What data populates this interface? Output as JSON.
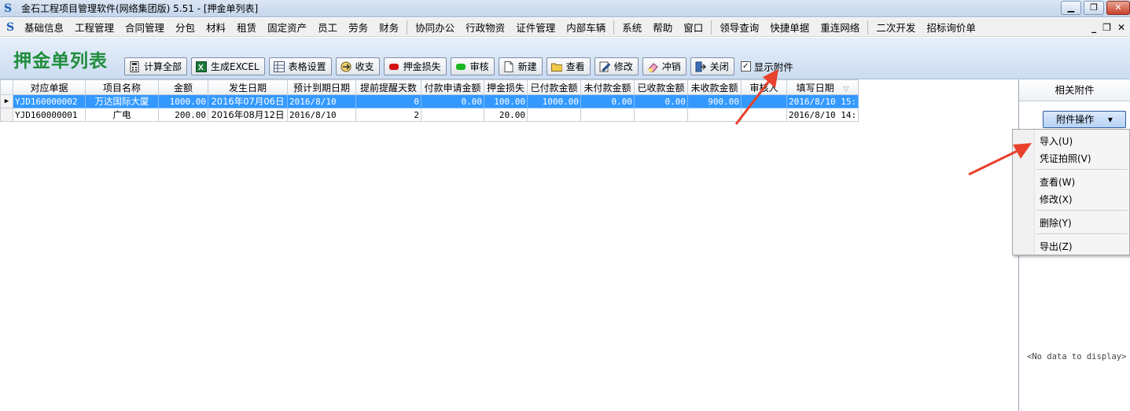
{
  "window": {
    "title": "金石工程项目管理软件(网络集团版) 5.51 - [押金单列表]",
    "minimize": "▁",
    "restore": "❐",
    "close": "✕"
  },
  "menubar": {
    "groups": [
      [
        "基础信息",
        "工程管理",
        "合同管理",
        "分包",
        "材料",
        "租赁",
        "固定资产",
        "员工",
        "劳务",
        "财务"
      ],
      [
        "协同办公",
        "行政物资",
        "证件管理",
        "内部车辆"
      ],
      [
        "系统",
        "帮助",
        "窗口"
      ],
      [
        "领导查询",
        "快捷单据",
        "重连网络"
      ],
      [
        "二次开发",
        "招标询价单"
      ]
    ],
    "mdi_minimize": "_",
    "mdi_restore": "❐",
    "mdi_close": "✕"
  },
  "page": {
    "title": "押金单列表"
  },
  "toolbar": {
    "buttons": [
      {
        "label": "计算全部",
        "icon": "calculator-icon"
      },
      {
        "label": "生成EXCEL",
        "icon": "excel-icon"
      },
      {
        "label": "表格设置",
        "icon": "table-settings-icon"
      },
      {
        "label": "收支",
        "icon": "transfer-icon"
      },
      {
        "label": "押金损失",
        "icon": "red-dot-icon"
      },
      {
        "label": "审核",
        "icon": "green-dot-icon"
      },
      {
        "label": "新建",
        "icon": "new-document-icon"
      },
      {
        "label": "查看",
        "icon": "folder-icon"
      },
      {
        "label": "修改",
        "icon": "edit-icon"
      },
      {
        "label": "冲销",
        "icon": "eraser-icon"
      },
      {
        "label": "关闭",
        "icon": "exit-icon"
      }
    ],
    "show_attachments": {
      "label": "显示附件",
      "checked": true,
      "mark": "✓"
    }
  },
  "grid": {
    "columns": [
      "对应单据",
      "项目名称",
      "金额",
      "发生日期",
      "预计到期日期",
      "提前提醒天数",
      "付款申请金额",
      "押金损失",
      "已付款金额",
      "未付款金额",
      "已收款金额",
      "未收款金额",
      "审核人",
      "填写日期"
    ],
    "sort_mark": "▽",
    "row_indicator": "▶",
    "rows": [
      [
        "YJD160000002",
        "万达国际大厦",
        "1000.00",
        "2016年07月06日",
        "2016/8/10",
        "0",
        "0.00",
        "100.00",
        "1000.00",
        "0.00",
        "0.00",
        "900.00",
        "",
        "2016/8/10 15:"
      ],
      [
        "YJD160000001",
        "广电",
        "200.00",
        "2016年08月12日",
        "2016/8/10",
        "2",
        "",
        "20.00",
        "",
        "",
        "",
        "",
        "",
        "2016/8/10 14:"
      ]
    ]
  },
  "attachments": {
    "header": "相关附件",
    "ops_button": "附件操作",
    "ops_caret": "▾",
    "empty_text": "<No data to display>",
    "menu": [
      "导入(U)",
      "凭证拍照(V)",
      "查看(W)",
      "修改(X)",
      "删除(Y)",
      "导出(Z)"
    ]
  },
  "colors": {
    "selected_row": "#3399ff",
    "title_green": "#1f8d3a",
    "annotation_arrow": "#e8412c"
  }
}
